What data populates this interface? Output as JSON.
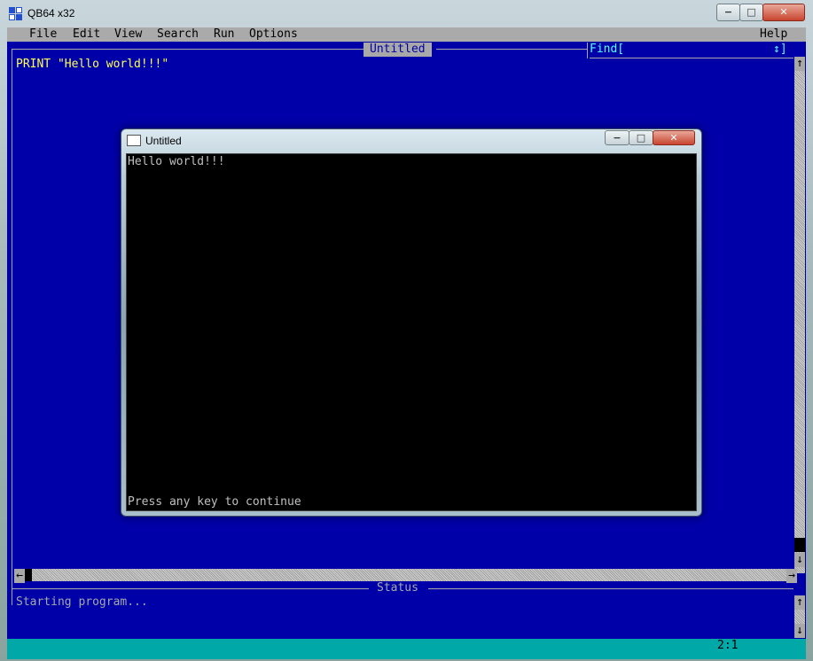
{
  "outer_window": {
    "title": "QB64 x32",
    "controls": {
      "minimize": "−",
      "maximize": "□",
      "close": "✕"
    }
  },
  "menu": {
    "items": [
      "File",
      "Edit",
      "View",
      "Search",
      "Run",
      "Options"
    ],
    "help": "Help"
  },
  "editor": {
    "tab_title": "Untitled",
    "find_label": "Find[",
    "find_toggle": "↕]",
    "code_lines": [
      "PRINT \"Hello world!!!\""
    ]
  },
  "status_panel": {
    "title": "Status",
    "message": "Starting program..."
  },
  "statusbar": {
    "cursor_position": "2:1"
  },
  "scrollbars": {
    "left_arrow": "←",
    "right_arrow": "→",
    "up_arrow": "↑",
    "down_arrow": "↓"
  },
  "program_window": {
    "title": "Untitled",
    "controls": {
      "minimize": "−",
      "maximize": "□",
      "close": "✕"
    },
    "output_line": "Hello world!!!",
    "prompt": "Press any key to continue"
  },
  "colors": {
    "editor_bg": "#0000a8",
    "code_text": "#ffff55",
    "status_text": "#a8a8a8",
    "find_text": "#55ffff",
    "statusbar_bg": "#00a8a8",
    "console_bg": "#000000"
  }
}
